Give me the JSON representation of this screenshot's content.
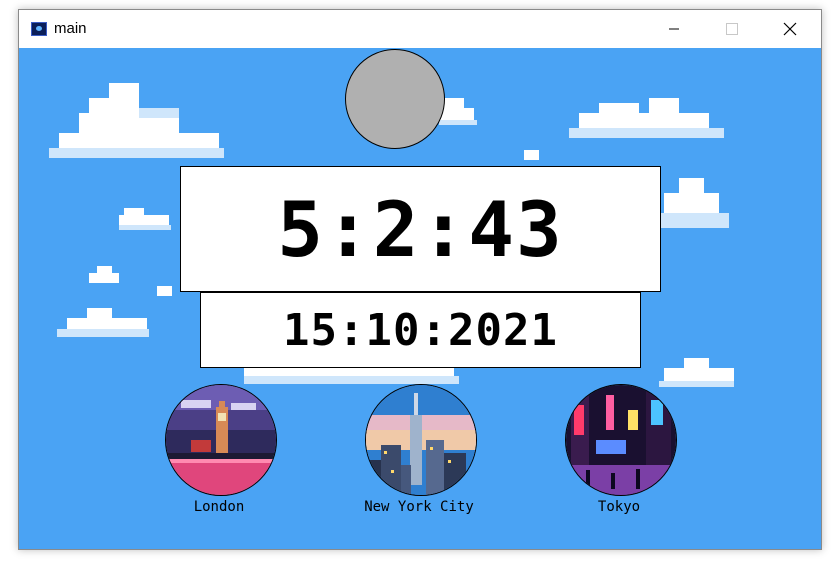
{
  "window": {
    "title": "main",
    "icon": "app-icon"
  },
  "titlebar_buttons": {
    "minimize_icon": "minimize-icon",
    "maximize_icon": "maximize-icon",
    "close_icon": "close-icon"
  },
  "clock": {
    "time": "5:2:43",
    "date": "15:10:2021"
  },
  "moon": {
    "color": "#b0b0b0"
  },
  "cities": [
    {
      "name": "London"
    },
    {
      "name": "New York City"
    },
    {
      "name": "Tokyo"
    }
  ],
  "colors": {
    "sky": "#4aa3f4",
    "cloud": "#ffffff",
    "cloud_shadow": "#cfe6fb"
  }
}
